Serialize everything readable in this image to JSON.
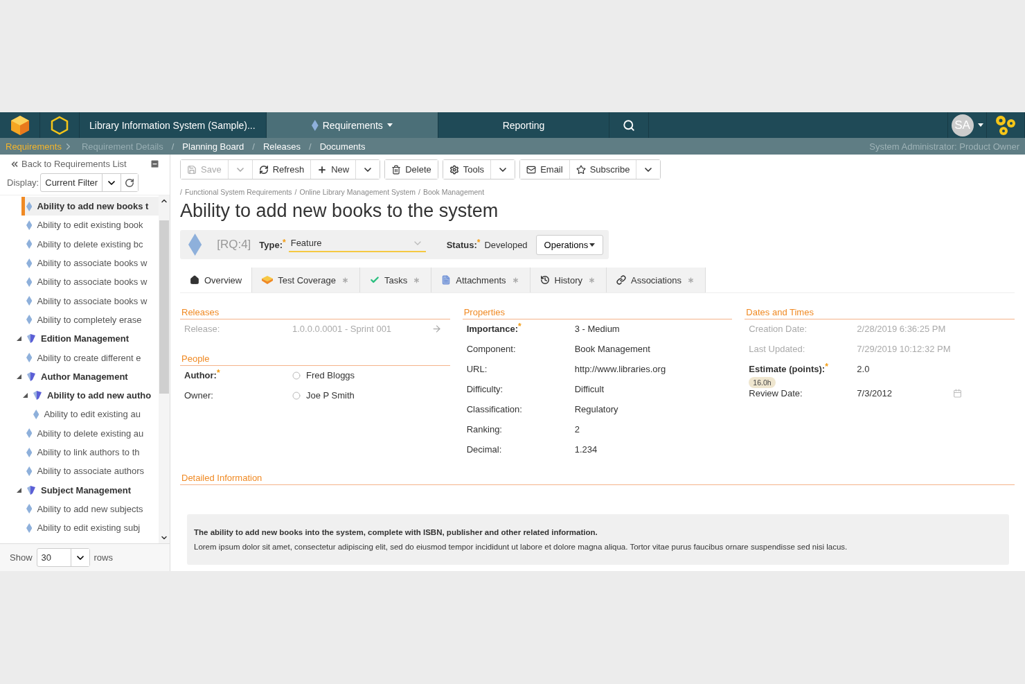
{
  "nav": {
    "project": "Library Information System (Sample)...",
    "module": "Requirements",
    "reporting": "Reporting",
    "avatar": "SA"
  },
  "subnav": {
    "items": [
      {
        "label": "Requirements",
        "kind": "current"
      },
      {
        "label": "Requirement Details",
        "kind": "disabled"
      },
      {
        "label": "/",
        "kind": "separator"
      },
      {
        "label": "Planning Board",
        "kind": "link"
      },
      {
        "label": "/",
        "kind": "separator"
      },
      {
        "label": "Releases",
        "kind": "link"
      },
      {
        "label": "/",
        "kind": "separator"
      },
      {
        "label": "Documents",
        "kind": "link"
      }
    ],
    "user": "System Administrator: Product Owner"
  },
  "sidebar": {
    "back": "Back to Requirements List",
    "display_label": "Display:",
    "filter": "Current Filter",
    "tree": [
      {
        "label": "Ability to add new books t",
        "kind": "requirement",
        "selected": true
      },
      {
        "label": "Ability to edit existing book",
        "kind": "requirement",
        "selected": false
      },
      {
        "label": "Ability to delete existing bc",
        "kind": "requirement",
        "selected": false
      },
      {
        "label": "Ability to associate books w",
        "kind": "requirement",
        "selected": false
      },
      {
        "label": "Ability to associate books w",
        "kind": "requirement",
        "selected": false
      },
      {
        "label": "Ability to associate books w",
        "kind": "requirement",
        "selected": false
      },
      {
        "label": "Ability to completely erase",
        "kind": "requirement",
        "selected": false
      },
      {
        "label": "Edition Management",
        "kind": "folder",
        "selected": false,
        "expanded": true,
        "children": [
          {
            "label": "Ability to create different e",
            "kind": "requirement",
            "selected": false
          }
        ]
      },
      {
        "label": "Author Management",
        "kind": "folder",
        "selected": false,
        "expanded": true,
        "children": [
          {
            "label": "Ability to add new autho",
            "kind": "folder",
            "selected": false,
            "expanded": true,
            "children": [
              {
                "label": "Ability to edit existing au",
                "kind": "requirement",
                "selected": false
              }
            ]
          },
          {
            "label": "Ability to delete existing au",
            "kind": "requirement",
            "selected": false
          },
          {
            "label": "Ability to link authors to th",
            "kind": "requirement",
            "selected": false
          },
          {
            "label": "Ability to associate authors",
            "kind": "requirement",
            "selected": false
          }
        ]
      },
      {
        "label": "Subject Management",
        "kind": "folder",
        "selected": false,
        "expanded": true,
        "children": [
          {
            "label": "Ability to add new subjects",
            "kind": "requirement",
            "selected": false
          },
          {
            "label": "Ability to edit existing subj",
            "kind": "requirement",
            "selected": false
          }
        ]
      }
    ],
    "show_label": "Show",
    "rows": "30",
    "rows_label": "rows"
  },
  "toolbar": [
    [
      {
        "label": "Save",
        "kind": "save",
        "disabled": true
      },
      {
        "kind": "caret",
        "disabled": true
      },
      {
        "label": "Refresh",
        "kind": "refresh",
        "disabled": false
      },
      {
        "label": "New",
        "kind": "new",
        "disabled": false
      },
      {
        "kind": "caret",
        "disabled": false
      }
    ],
    [
      {
        "label": "Delete",
        "kind": "delete",
        "disabled": false
      }
    ],
    [
      {
        "label": "Tools",
        "kind": "tools",
        "disabled": false
      },
      {
        "kind": "caret",
        "disabled": false
      }
    ],
    [
      {
        "label": "Email",
        "kind": "email",
        "disabled": false
      },
      {
        "label": "Subscribe",
        "kind": "subscribe",
        "disabled": false
      },
      {
        "kind": "caret",
        "disabled": false
      }
    ]
  ],
  "breadcrumb": {
    "separator": "/",
    "path": [
      "Functional System Requirements",
      "Online Library Management System",
      "Book Management"
    ]
  },
  "title": "Ability to add new books to the system",
  "required_mark": "*",
  "header": {
    "id": "[RQ:4]",
    "type_label": "Type:",
    "type": "Feature",
    "status_label": "Status:",
    "status": "Developed",
    "operations": "Operations"
  },
  "tabs": [
    {
      "label": "Overview",
      "kind": "overview",
      "selected": true,
      "marker": false
    },
    {
      "label": "Test Coverage",
      "kind": "coverage",
      "selected": false,
      "marker": true
    },
    {
      "label": "Tasks",
      "kind": "tasks",
      "selected": false,
      "marker": true
    },
    {
      "label": "Attachments",
      "kind": "attachments",
      "selected": false,
      "marker": true
    },
    {
      "label": "History",
      "kind": "history",
      "selected": false,
      "marker": true
    },
    {
      "label": "Associations",
      "kind": "associations",
      "selected": false,
      "marker": true
    }
  ],
  "columns": [
    [
      {
        "title": "Releases",
        "fields": [
          {
            "label": "Release:",
            "value": "1.0.0.0.0001 - Sprint 001",
            "kind": "link",
            "disabled": true,
            "required": false
          }
        ]
      },
      {
        "title": "People",
        "fields": [
          {
            "label": "Author:",
            "value": "Fred Bloggs",
            "kind": "user",
            "disabled": false,
            "required": true
          },
          {
            "label": "Owner:",
            "value": "Joe P Smith",
            "kind": "user",
            "disabled": false,
            "required": false
          }
        ]
      }
    ],
    [
      {
        "title": "Properties",
        "fields": [
          {
            "label": "Importance:",
            "value": "3 - Medium",
            "kind": "text",
            "disabled": false,
            "required": true
          },
          {
            "label": "Component:",
            "value": "Book Management",
            "kind": "text",
            "disabled": false,
            "required": false
          },
          {
            "label": "URL:",
            "value": "http://www.libraries.org",
            "kind": "text",
            "disabled": false,
            "required": false
          },
          {
            "label": "Difficulty:",
            "value": "Difficult",
            "kind": "text",
            "disabled": false,
            "required": false
          },
          {
            "label": "Classification:",
            "value": "Regulatory",
            "kind": "text",
            "disabled": false,
            "required": false
          },
          {
            "label": "Ranking:",
            "value": "2",
            "kind": "text",
            "disabled": false,
            "required": false
          },
          {
            "label": "Decimal:",
            "value": "1.234",
            "kind": "text",
            "disabled": false,
            "required": false
          }
        ]
      }
    ],
    [
      {
        "title": "Dates and Times",
        "fields": [
          {
            "label": "Creation Date:",
            "value": "2/28/2019 6:36:25 PM",
            "kind": "text",
            "disabled": true,
            "required": false
          },
          {
            "label": "Last Updated:",
            "value": "7/29/2019 10:12:32 PM",
            "kind": "text",
            "disabled": true,
            "required": false
          },
          {
            "label": "Estimate (points):",
            "value": "2.0",
            "kind": "estimate",
            "badge": "16.0h",
            "disabled": false,
            "required": true
          },
          {
            "label": "Review Date:",
            "value": "7/3/2012",
            "kind": "date",
            "disabled": false,
            "required": false
          }
        ]
      }
    ]
  ],
  "details": {
    "title": "Detailed Information",
    "paragraphs": [
      {
        "text": "The ability to add new books into the system, complete with ISBN, publisher and other related information.",
        "bold": true
      },
      {
        "text": "Lorem ipsum dolor sit amet, consectetur adipiscing elit, sed do eiusmod tempor incididunt ut labore et dolore magna aliqua. Tortor vitae purus faucibus ornare suspendisse sed nisi lacus.",
        "bold": false
      }
    ]
  }
}
